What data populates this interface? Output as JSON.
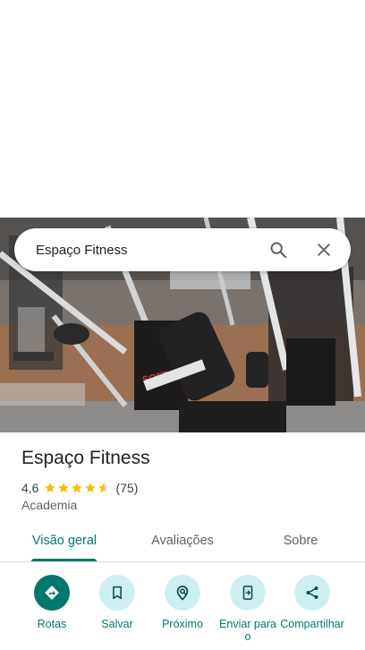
{
  "search": {
    "query": "Espaço Fitness"
  },
  "place": {
    "name": "Espaço Fitness",
    "rating": "4,6",
    "stars": 4.6,
    "reviews_count": "(75)",
    "category": "Academia"
  },
  "tabs": [
    {
      "label": "Visão geral",
      "selected": true
    },
    {
      "label": "Avaliações",
      "selected": false
    },
    {
      "label": "Sobre",
      "selected": false
    }
  ],
  "actions": [
    {
      "label": "Rotas",
      "icon": "directions-icon"
    },
    {
      "label": "Salvar",
      "icon": "bookmark-icon"
    },
    {
      "label": "Próximo",
      "icon": "nearby-icon"
    },
    {
      "label": "Enviar para o",
      "icon": "send-to-phone-icon"
    },
    {
      "label": "Compartilhar",
      "icon": "share-icon"
    }
  ],
  "colors": {
    "accent": "#00796b",
    "action_bg": "#cdeff2",
    "star": "#fbbc04",
    "star_empty": "#dadce0"
  }
}
